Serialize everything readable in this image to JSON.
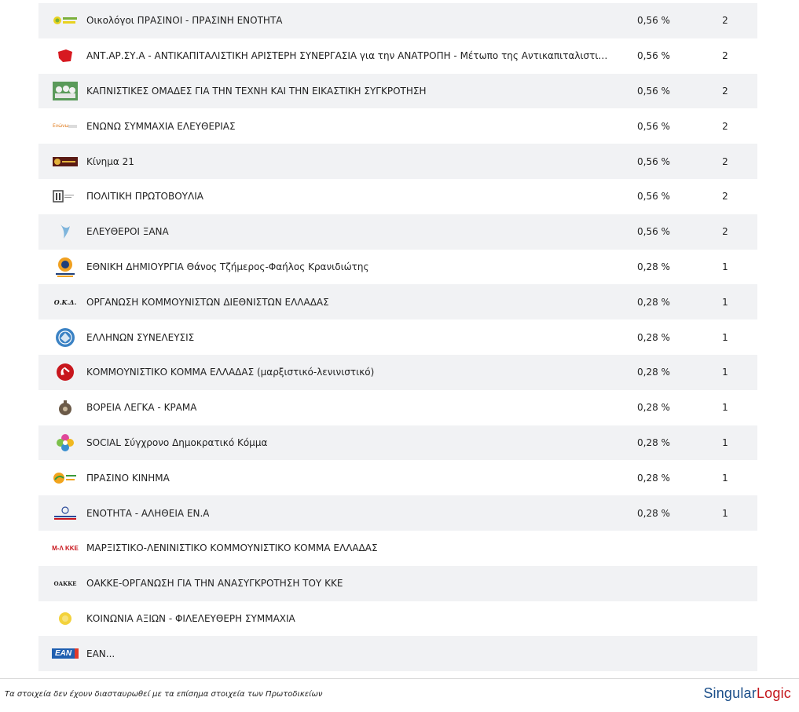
{
  "rows": [
    {
      "name": "Οικολόγοι ΠΡΑΣΙΝΟΙ - ΠΡΑΣΙΝΗ ΕΝΟΤΗΤΑ",
      "pct": "0,56 %",
      "seats": "2",
      "logo": "green-sun-logo"
    },
    {
      "name": "ΑΝΤ.ΑΡ.ΣΥ.Α - ΑΝΤΙΚΑΠΙΤΑΛΙΣΤΙΚΗ ΑΡΙΣΤΕΡΗ ΣΥΝΕΡΓΑΣΙΑ για την ΑΝΑΤΡΟΠΗ - Μέτωπο της Αντικαπιταλιστικής...",
      "pct": "0,56 %",
      "seats": "2",
      "logo": "red-flag-logo"
    },
    {
      "name": "ΚΑΠΝΙΣΤΙΚΕΣ ΟΜΑΔΕΣ ΓΙΑ ΤΗΝ ΤΕΧΝΗ ΚΑΙ ΤΗΝ ΕΙΚΑΣΤΙΚΗ ΣΥΓΚΡΟΤΗΣΗ",
      "pct": "0,56 %",
      "seats": "2",
      "logo": "group-photo-logo"
    },
    {
      "name": "ΕΝΩΝΩ ΣΥΜΜΑΧΙΑ ΕΛΕΥΘΕΡΙΑΣ",
      "pct": "0,56 %",
      "seats": "2",
      "logo": "enono-logo"
    },
    {
      "name": "Κίνημα 21",
      "pct": "0,56 %",
      "seats": "2",
      "logo": "kinima21-logo"
    },
    {
      "name": "ΠΟΛΙΤΙΚΗ ΠΡΩΤΟΒΟΥΛΙΑ",
      "pct": "0,56 %",
      "seats": "2",
      "logo": "pp-logo"
    },
    {
      "name": "ΕΛΕΥΘΕΡΟΙ ΞΑΝΑ",
      "pct": "0,56 %",
      "seats": "2",
      "logo": "bird-logo"
    },
    {
      "name": "ΕΘΝΙΚΗ ΔΗΜΙΟΥΡΓΙΑ Θάνος Τζήμερος-Φαήλος Κρανιδιώτης",
      "pct": "0,28 %",
      "seats": "1",
      "logo": "ethniki-dimiourgia-logo"
    },
    {
      "name": "ΟΡΓΑΝΩΣΗ ΚΟΜΜΟΥΝΙΣΤΩΝ ΔΙΕΘΝΙΣΤΩΝ ΕΛΛΑΔΑΣ",
      "pct": "0,28 %",
      "seats": "1",
      "logo": "okd-logo"
    },
    {
      "name": "ΕΛΛΗΝΩΝ ΣΥΝΕΛΕΥΣΙΣ",
      "pct": "0,28 %",
      "seats": "1",
      "logo": "blue-circle-logo"
    },
    {
      "name": "ΚΟΜΜΟΥΝΙΣΤΙΚΟ ΚΟΜΜΑ ΕΛΛΑΔΑΣ (μαρξιστικό-λενινιστικό)",
      "pct": "0,28 %",
      "seats": "1",
      "logo": "hammer-sickle-logo"
    },
    {
      "name": "ΒΟΡΕΙΑ ΛΕΓΚΑ - ΚΡΑΜΑ",
      "pct": "0,28 %",
      "seats": "1",
      "logo": "kettle-logo"
    },
    {
      "name": "SOCIAL Σύγχρονο Δημοκρατικό Κόμμα",
      "pct": "0,28 %",
      "seats": "1",
      "logo": "flower-logo"
    },
    {
      "name": "ΠΡΑΣΙΝΟ ΚΙΝΗΜΑ",
      "pct": "0,28 %",
      "seats": "1",
      "logo": "prasino-kinima-logo"
    },
    {
      "name": "ΕΝΟΤΗΤΑ - ΑΛΗΘΕΙΑ ΕΝ.Α",
      "pct": "0,28 %",
      "seats": "1",
      "logo": "ena-logo"
    },
    {
      "name": "ΜΑΡΞΙΣΤΙΚΟ-ΛΕΝΙΝΙΣΤΙΚΟ ΚΟΜΜΟΥΝΙΣΤΙΚΟ ΚΟΜΜΑ ΕΛΛΑΔΑΣ",
      "pct": "",
      "seats": "",
      "logo": "ml-kke-logo"
    },
    {
      "name": "ΟΑΚΚΕ-ΟΡΓΑΝΩΣΗ ΓΙΑ ΤΗΝ ΑΝΑΣΥΓΚΡΟΤΗΣΗ ΤΟΥ ΚΚΕ",
      "pct": "",
      "seats": "",
      "logo": "oakke-logo"
    },
    {
      "name": "ΚΟΙΝΩΝΙΑ ΑΞΙΩΝ - ΦΙΛΕΛΕΥΘΕΡΗ ΣΥΜΜΑΧΙΑ",
      "pct": "",
      "seats": "",
      "logo": "yellow-circle-logo"
    },
    {
      "name": "ΕΑΝ...",
      "pct": "",
      "seats": "",
      "logo": "ean-logo"
    }
  ],
  "logo_text": {
    "okd": "Ο.Κ.Δ.",
    "ml_kke": "Μ-Λ ΚΚΕ",
    "oakke": "ΟΑΚΚΕ",
    "ean": "ΕΑΝ"
  },
  "footer": {
    "note": "Τα στοιχεία δεν έχουν διασταυρωθεί με τα επίσημα στοιχεία των Πρωτοδικείων",
    "brand_part1": "Singular",
    "brand_part2": "Logic"
  },
  "colors": {
    "row_alt_bg": "#f1f2f4",
    "brand_blue": "#1c4f8a",
    "brand_red": "#c4161c"
  }
}
